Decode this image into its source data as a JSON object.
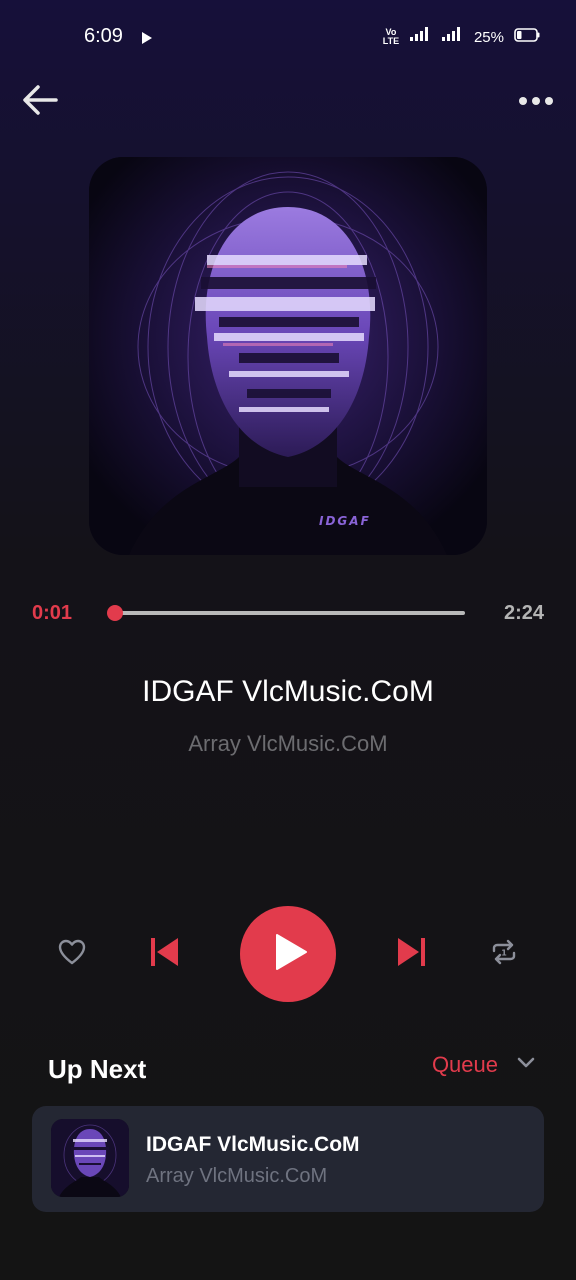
{
  "status_bar": {
    "time": "6:09",
    "network_label": "Vo LTE",
    "battery_percent": "25%",
    "battery_level": 0.25,
    "icons": [
      "play-icon",
      "signal-icon",
      "battery-icon"
    ]
  },
  "header": {
    "back_icon": "arrow-left-icon",
    "more_icon": "more-horizontal-icon"
  },
  "album": {
    "art_text": "IDGAF"
  },
  "player": {
    "current_time": "0:01",
    "total_time": "2:24",
    "progress": 0.007,
    "track_title": "IDGAF VlcMusic.CoM",
    "track_artist": "Array VlcMusic.CoM"
  },
  "controls": {
    "favorite_icon": "heart-outline-icon",
    "previous_icon": "skip-previous-icon",
    "play_icon": "play-icon",
    "next_icon": "skip-next-icon",
    "repeat_icon": "repeat-icon"
  },
  "up_next": {
    "title": "Up Next",
    "queue_label": "Queue",
    "queue_icon": "chevron-down-icon",
    "items": [
      {
        "title": "IDGAF VlcMusic.CoM",
        "artist": "Array VlcMusic.CoM"
      }
    ]
  },
  "colors": {
    "accent": "#e23b4c",
    "background_top": "#16103a",
    "background": "#141414",
    "card": "#242733",
    "muted_text": "#6c6c70"
  }
}
